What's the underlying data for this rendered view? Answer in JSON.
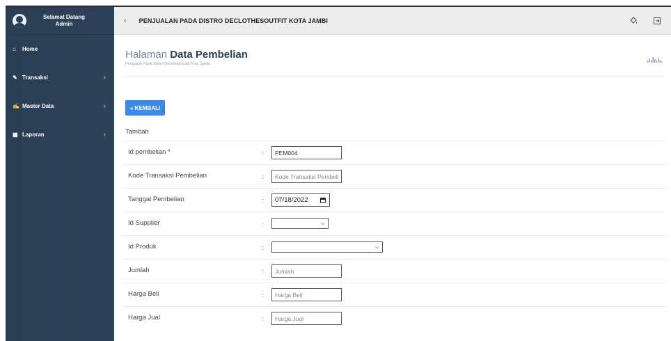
{
  "sidebar": {
    "greeting": "Selamat Datang",
    "user": "Admin",
    "items": [
      {
        "label": "Home",
        "icon": "home-icon",
        "glyph": "⌂"
      },
      {
        "label": "Transaksi",
        "icon": "pencil-icon",
        "glyph": "✎",
        "chevron": "›"
      },
      {
        "label": "Master Data",
        "icon": "edit-icon",
        "glyph": "✍",
        "chevron": "›"
      },
      {
        "label": "Laporan",
        "icon": "calendar-icon",
        "glyph": "▦",
        "chevron": "›"
      }
    ]
  },
  "topbar": {
    "back_glyph": "‹",
    "title": "PENJUALAN PADA DISTRO DECLOTHESOUTFIT KOTA JAMBI"
  },
  "page": {
    "title_light": "Halaman ",
    "title_bold": "Data Pembelian",
    "subtitle": "Penjualan Pada Distro Declothesoutfit Kota Jambi",
    "back_button": "« KEMBALI",
    "form_heading": "Tambah"
  },
  "form": {
    "colon": ":",
    "fields": [
      {
        "label": "Id pembelian *",
        "value": "PEM004",
        "placeholder": ""
      },
      {
        "label": "Kode Transaksi Pembelian",
        "value": "",
        "placeholder": "Kode Transaksi Pembelian"
      },
      {
        "label": "Tanggal Pembelian",
        "value": "07/18/2022"
      },
      {
        "label": "Id Supplier",
        "value": ""
      },
      {
        "label": "Id Produk",
        "value": ""
      },
      {
        "label": "Jumlah",
        "value": "",
        "placeholder": "Jumlah"
      },
      {
        "label": "Harga Beli",
        "value": "",
        "placeholder": "Harga Beli"
      },
      {
        "label": "Harga Jual",
        "value": "",
        "placeholder": "Harga Jual"
      }
    ]
  },
  "colors": {
    "sidebar": "#2a3f54",
    "button": "#3c8ce7",
    "topbar": "#ededed"
  }
}
